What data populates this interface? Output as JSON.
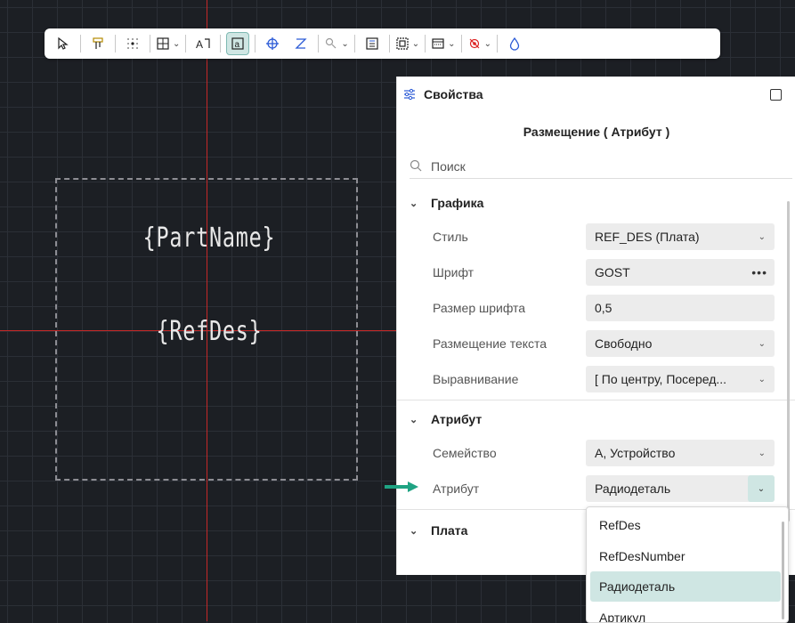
{
  "canvas": {
    "part_name": "{PartName}",
    "ref_des": "{RefDes}"
  },
  "toolbar": {
    "items": [
      {
        "icon": "select-arrow-icon"
      },
      {
        "icon": "pin-icon"
      },
      {
        "icon": "snap-grid-icon"
      },
      {
        "icon": "grid-icon"
      },
      {
        "icon": "text-icon"
      },
      {
        "icon": "attribute-icon"
      },
      {
        "icon": "origin-icon"
      },
      {
        "icon": "wire-icon"
      },
      {
        "icon": "zoom-icon"
      },
      {
        "icon": "list-icon"
      },
      {
        "icon": "frame-icon"
      },
      {
        "icon": "layers-icon"
      },
      {
        "icon": "visibility-icon"
      },
      {
        "icon": "fill-icon"
      }
    ]
  },
  "panel": {
    "title": "Свойства",
    "subtitle": "Размещение ( Атрибут )",
    "search_placeholder": "Поиск",
    "sections": {
      "graphics": "Графика",
      "attribute": "Атрибут",
      "board": "Плата"
    },
    "graphics_rows": [
      {
        "label": "Стиль",
        "value": "REF_DES (Плата)"
      },
      {
        "label": "Шрифт",
        "value": "GOST"
      },
      {
        "label": "Размер шрифта",
        "value": "0,5"
      },
      {
        "label": "Размещение текста",
        "value": "Свободно"
      },
      {
        "label": "Выравнивание",
        "value": "[ По центру, Посеред..."
      }
    ],
    "attribute_rows": [
      {
        "label": "Семейство",
        "value": "А, Устройство"
      },
      {
        "label": "Атрибут",
        "value": "Радиодеталь"
      }
    ]
  },
  "dropdown": {
    "options": [
      "RefDes",
      "RefDesNumber",
      "Радиодеталь",
      "Артикул"
    ],
    "selected": "Радиодеталь"
  },
  "colors": {
    "accent": "#cfe6e3",
    "crosshair": "#c52828",
    "arrow": "#1fa383"
  }
}
